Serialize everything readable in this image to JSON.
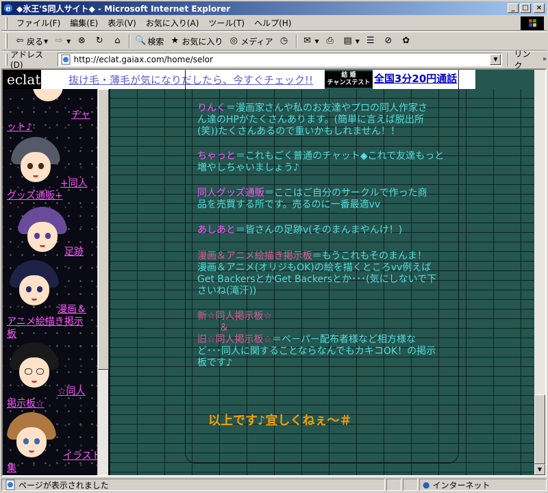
{
  "window": {
    "title": "◆氷王'S同人サイト◆ - Microsoft Internet Explorer",
    "min_label": "_",
    "max_label": "□",
    "close_label": "×"
  },
  "menu": {
    "items": [
      "ファイル(F)",
      "編集(E)",
      "表示(V)",
      "お気に入り(A)",
      "ツール(T)",
      "ヘルプ(H)"
    ]
  },
  "toolbar": {
    "back_label": "戻る",
    "search_label": "検索",
    "favorites_label": "お気に入り",
    "media_label": "メディア"
  },
  "address": {
    "label": "アドレス(D)",
    "url": "http://eclat.gaiax.com/home/selor",
    "links_label": "リンク"
  },
  "banner": {
    "logo": "eclat",
    "ad1": "抜け毛・薄毛が気になりだしたら、今すぐチェック!!",
    "ad2_line1": "結 婚",
    "ad2_line2": "チャンステスト",
    "ad3": "全国3分20円通話"
  },
  "sidebar": {
    "links": [
      {
        "text": "チャ"
      },
      {
        "text": "ット♪"
      },
      {
        "text": "+同人"
      },
      {
        "text": "グッズ通販+"
      },
      {
        "text": "足跡"
      },
      {
        "text": "漫画＆"
      },
      {
        "text": "アニメ絵描き掲示"
      },
      {
        "text": "板"
      },
      {
        "text": "☆同人"
      },
      {
        "text": "掲示板☆"
      },
      {
        "text": "イラスト"
      },
      {
        "text": "集"
      }
    ]
  },
  "main": {
    "p1_term": "りんく",
    "p1_body_a": "＝漫画家さんや私のお友達やプロの同人作家さ",
    "p1_body_b": "ん達のHPがたくさんあります。(簡単に言えば脱出所",
    "p1_body_c": "(笑))たくさんあるので重いかもしれません！！",
    "p2_term": "ちゃっと",
    "p2_body_a": "＝これもごく普通のチャット◆これで友達もっと",
    "p2_body_b": "増やしちゃいましょう♪",
    "p3_term": "同人グッズ通販",
    "p3_body_a": "＝ここはご自分のサークルで作った商",
    "p3_body_b": "品を売買する所です。売るのに一番最適vv",
    "p4_term": "あしあと",
    "p4_body": "＝皆さんの足跡v(そのまんまやんけ！)",
    "p5_term": "漫画＆アニメ絵描き掲示板",
    "p5_body_a": "＝もうこれもそのまんま！",
    "p5_body_b": "漫画＆アニメ(オリジもOK)の絵を描くところvv例えば",
    "p5_body_c": "Get BackersとかGet Backersとか･･･(気にしないで下",
    "p5_body_d": "さいね(滝汗))",
    "p6_term_a": "新☆同人掲示板☆",
    "p6_amp": "＆",
    "p6_term_b": "旧☆同人掲示板☆",
    "p6_body_a": "＝ペーパー配布者様など相方様な",
    "p6_body_b": "ど･･･同人に関することならなんでもカキコOK！の掲示",
    "p6_body_c": "板です♪",
    "closing": "以上です♪宜しくねぇ〜＃"
  },
  "status": {
    "message": "ページが表示されました",
    "zone": "インターネット"
  },
  "colors": {
    "link": "#ff55ff",
    "body_text": "#55dddd",
    "closing": "#f5a000",
    "brick": "#255650"
  }
}
